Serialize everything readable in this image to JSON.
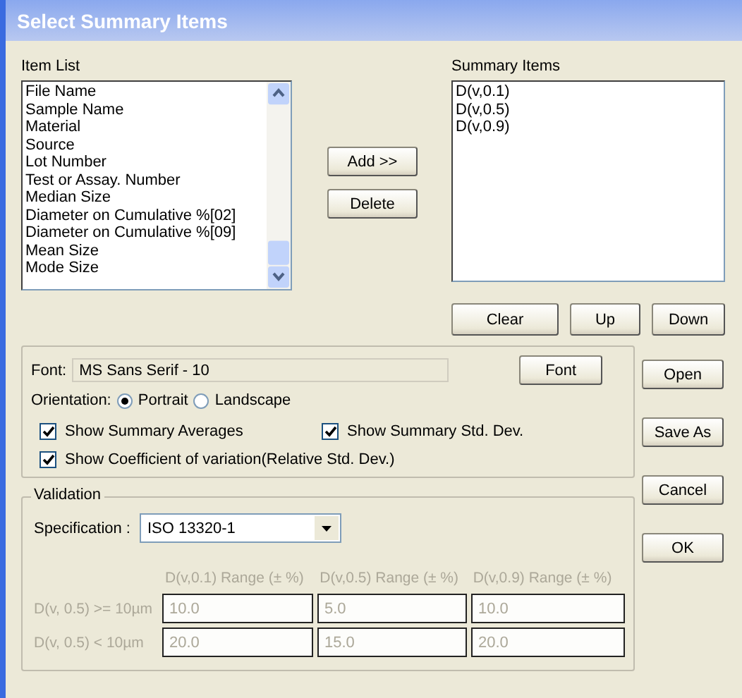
{
  "window": {
    "title": "Select Summary Items"
  },
  "item_list": {
    "label": "Item List",
    "items": [
      "File Name",
      "Sample Name",
      "Material",
      "Source",
      "Lot Number",
      "Test or Assay. Number",
      "Median Size",
      "Diameter on Cumulative %[02]",
      "Diameter on Cumulative %[09]",
      "Mean Size",
      "Mode Size"
    ]
  },
  "move_buttons": [
    "Add >>",
    "Delete"
  ],
  "summary_items": {
    "label": "Summary Items",
    "items": [
      "D(v,0.1)",
      "D(v,0.5)",
      "D(v,0.9)"
    ]
  },
  "order_buttons": [
    "Clear",
    "Up",
    "Down"
  ],
  "font": {
    "label": "Font:",
    "value": "MS Sans Serif - 10",
    "button": "Font"
  },
  "orientation": {
    "label": "Orientation:",
    "options": [
      {
        "label": "Portrait",
        "selected": true
      },
      {
        "label": "Landscape",
        "selected": false
      }
    ]
  },
  "options": [
    {
      "label": "Show Summary Averages",
      "checked": true
    },
    {
      "label": "Show Summary Std. Dev.",
      "checked": true
    },
    {
      "label": "Show Coefficient of variation(Relative Std. Dev.)",
      "checked": true
    }
  ],
  "validation": {
    "title": "Validation",
    "specification_label": "Specification :",
    "specification": "ISO 13320-1",
    "disabled": true,
    "columns": [
      "D(v,0.1) Range (± %)",
      "D(v,0.5) Range (± %)",
      "D(v,0.9) Range (± %)"
    ],
    "rows": [
      {
        "label": "D(v, 0.5) >= 10µm",
        "values": [
          "10.0",
          "5.0",
          "10.0"
        ]
      },
      {
        "label": "D(v, 0.5) < 10µm",
        "values": [
          "20.0",
          "15.0",
          "20.0"
        ]
      }
    ]
  },
  "side_buttons": [
    "Open",
    "Save As",
    "Cancel",
    "OK"
  ]
}
